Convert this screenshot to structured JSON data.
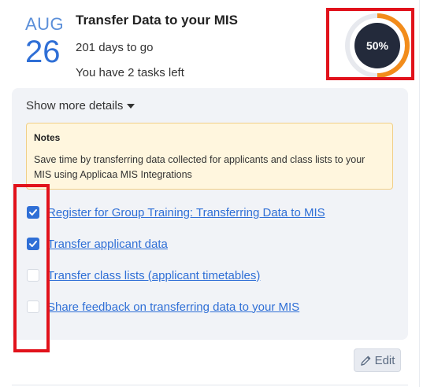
{
  "date": {
    "month": "AUG",
    "day": "26"
  },
  "task": {
    "title": "Transfer Data to your MIS",
    "days_to_go": "201 days to go",
    "tasks_left": "You have 2 tasks left"
  },
  "progress": {
    "label": "50%",
    "value": 0.5,
    "track_color": "#e7e9ee",
    "fill_color": "#f28c1b",
    "center_color": "#232a3b"
  },
  "details": {
    "toggle_label": "Show more details",
    "notes": {
      "title": "Notes",
      "body": "Save time by transferring data collected for applicants and class lists to your MIS using Applicaa MIS Integrations"
    },
    "items": [
      {
        "label": "Register for Group Training: Transferring Data to MIS",
        "checked": true
      },
      {
        "label": "Transfer applicant data",
        "checked": true
      },
      {
        "label": "Transfer class lists (applicant timetables)",
        "checked": false
      },
      {
        "label": "Share feedback on transferring data to your MIS",
        "checked": false
      }
    ]
  },
  "actions": {
    "edit_label": "Edit"
  },
  "colors": {
    "accent": "#2f6fd6",
    "highlight": "#e1121b",
    "notes_bg": "#fff6de"
  }
}
